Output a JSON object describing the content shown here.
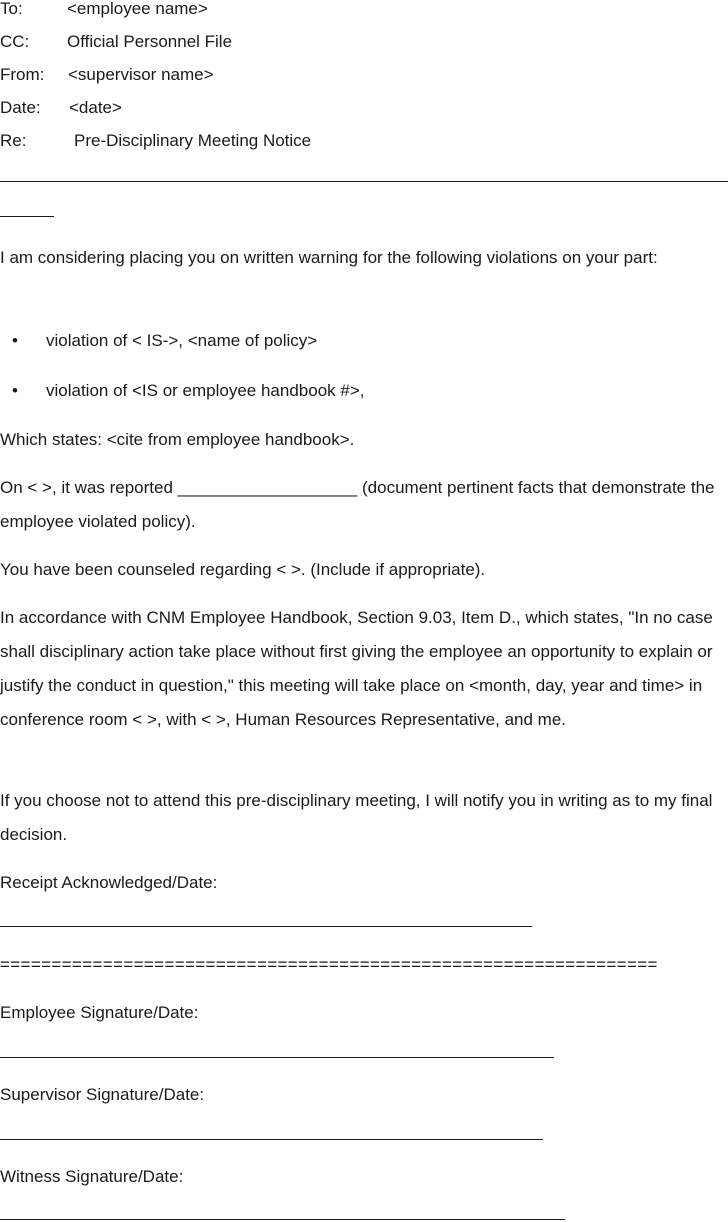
{
  "memo_header": {
    "to_label": "To:",
    "to_value": "<employee name>",
    "cc_label": "CC:",
    "cc_value": "Official Personnel File",
    "from_label": "From:",
    "from_value": "<supervisor name>",
    "date_label": "Date:",
    "date_value": "<date>",
    "re_label": "Re:",
    "re_value": "Pre-Disciplinary Meeting Notice"
  },
  "body": {
    "intro": "I am considering placing you on written warning for the following violations on your part:",
    "bullets": [
      "violation of < IS->, <name of policy>",
      "violation of <IS or employee handbook #>,"
    ],
    "which_states": "Which states: <cite from employee handbook>.",
    "reported": "On < >, it was reported ___________________ (document pertinent facts that demonstrate the employee violated policy).",
    "counseled": "You have been counseled regarding <   >. (Include if appropriate).",
    "accordance": "In accordance with CNM Employee Handbook, Section 9.03, Item D., which states, \"In no case shall disciplinary action take place without first giving the employee an opportunity to explain or justify the conduct in question,\" this meeting will take place on <month, day, year and time> in conference room < >, with <   >, Human Resources Representative, and me.",
    "choose_not": "If you choose not to attend this pre-disciplinary meeting, I will notify you in writing as to my final decision."
  },
  "signatures": {
    "receipt_label": "Receipt Acknowledged/Date:",
    "separator": "================================================================",
    "employee_label": "Employee Signature/Date:",
    "supervisor_label": "Supervisor Signature/Date:",
    "witness_label": "Witness Signature/Date:"
  }
}
